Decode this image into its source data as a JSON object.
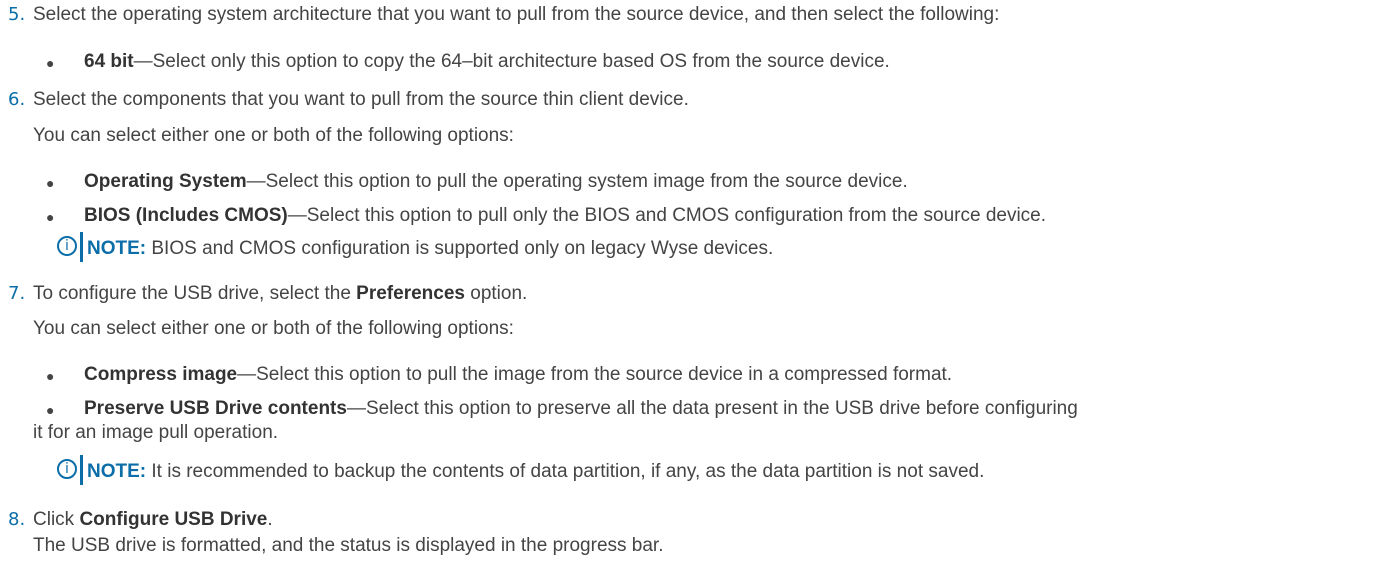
{
  "steps": [
    {
      "num": "5.",
      "text": "Select the operating system architecture that you want to pull from the source device, and then select the following:"
    },
    {
      "num": "6.",
      "text": "Select the components that you want to pull from the source thin client device.",
      "sub": "You can select either one or both of the following options:"
    },
    {
      "num": "7.",
      "text_before": "To configure the USB drive, select the ",
      "bold": "Preferences",
      "text_after": " option.",
      "sub": "You can select either one or both of the following options:"
    },
    {
      "num": "8.",
      "text_before": "Click ",
      "bold": "Configure USB Drive",
      "text_after": ".",
      "sub": "The USB drive is formatted, and the status is displayed in the progress bar."
    }
  ],
  "bullets": {
    "b64": {
      "term": "64 bit",
      "desc": "—Select only this option to copy the 64–bit architecture based OS from the source device."
    },
    "os": {
      "term": "Operating System",
      "desc": "—Select this option to pull the operating system image from the source device."
    },
    "bios": {
      "term": "BIOS (Includes CMOS)",
      "desc": "—Select this option to pull only the BIOS and CMOS configuration from the source device."
    },
    "compress": {
      "term": "Compress image",
      "desc": "—Select this option to pull the image from the source device in a compressed format."
    },
    "preserve": {
      "term": "Preserve USB Drive contents",
      "desc": "—Select this option to preserve all the data present in the USB drive before configuring",
      "desc2": "it for an image pull operation."
    }
  },
  "notes": [
    {
      "label": "NOTE:",
      "text": " BIOS and CMOS configuration is supported only on legacy Wyse devices."
    },
    {
      "label": "NOTE:",
      "text": " It is recommended to backup the contents of data partition, if any, as the data partition is not saved."
    }
  ],
  "bullet_glyph": "●",
  "note_icon_glyph": "i",
  "colors": {
    "accent": "#0b6ea8",
    "text": "#444444"
  },
  "icons": [
    "info-circle-icon"
  ]
}
